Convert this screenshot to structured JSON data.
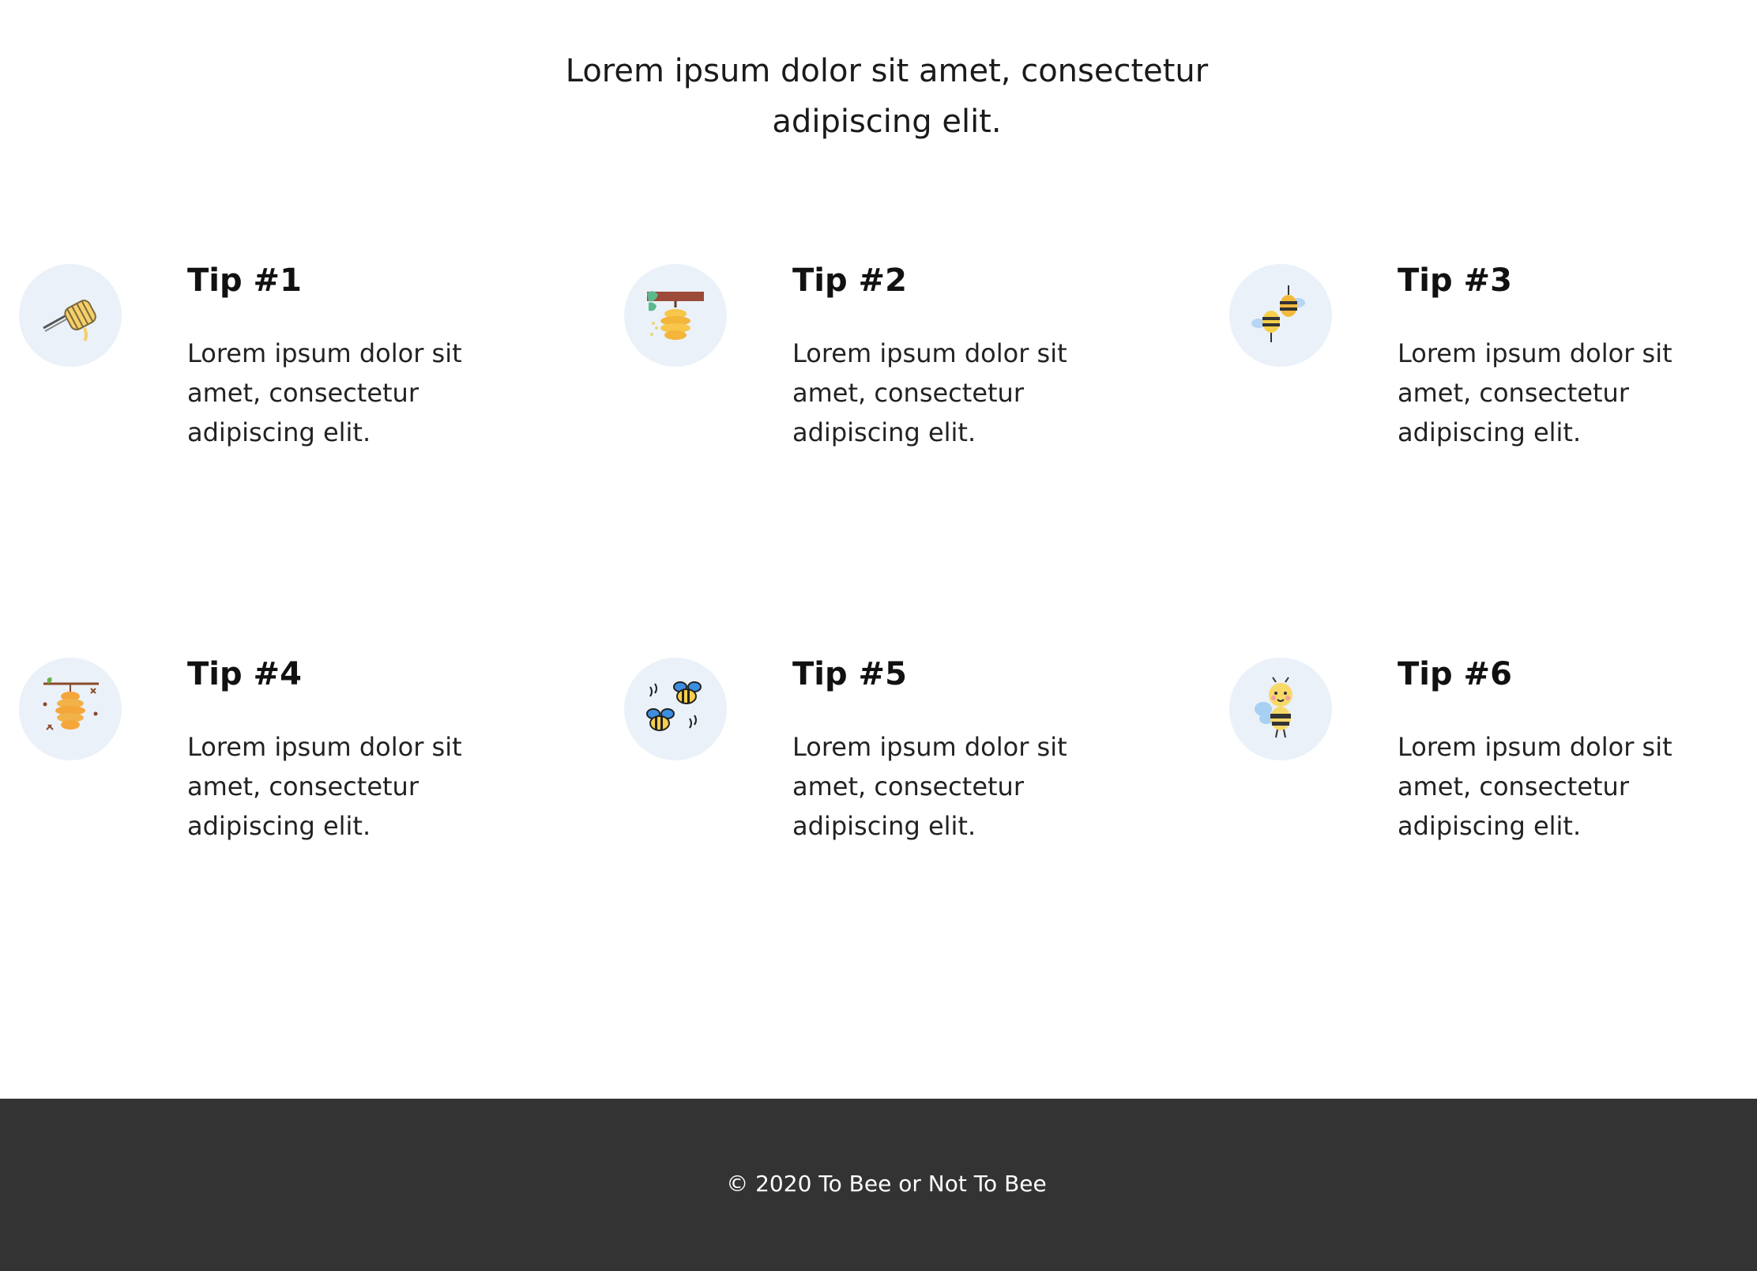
{
  "intro": {
    "line1": "Lorem ipsum dolor sit amet, consectetur",
    "line2": "adipiscing elit."
  },
  "tips": [
    {
      "title": "Tip #1",
      "icon": "honey-dipper-icon",
      "line1": "Lorem ipsum dolor sit",
      "line2": "amet, consectetur",
      "line3": "adipiscing elit."
    },
    {
      "title": "Tip #2",
      "icon": "hanging-beehive-icon",
      "line1": "Lorem ipsum dolor sit",
      "line2": "amet, consectetur",
      "line3": "adipiscing elit."
    },
    {
      "title": "Tip #3",
      "icon": "two-bees-icon",
      "line1": "Lorem ipsum dolor sit",
      "line2": "amet, consectetur",
      "line3": "adipiscing elit."
    },
    {
      "title": "Tip #4",
      "icon": "beehive-branch-icon",
      "line1": "Lorem ipsum dolor sit",
      "line2": "amet, consectetur",
      "line3": "adipiscing elit."
    },
    {
      "title": "Tip #5",
      "icon": "flying-bees-icon",
      "line1": "Lorem ipsum dolor sit",
      "line2": "amet, consectetur",
      "line3": "adipiscing elit."
    },
    {
      "title": "Tip #6",
      "icon": "cute-bee-icon",
      "line1": "Lorem ipsum dolor sit",
      "line2": "amet, consectetur",
      "line3": "adipiscing elit."
    }
  ],
  "footer": {
    "copyright": "© 2020 To Bee or Not To Bee"
  },
  "colors": {
    "icon_circle_bg": "#eaf1f9",
    "footer_bg": "#333333",
    "footer_text": "#ffffff"
  }
}
